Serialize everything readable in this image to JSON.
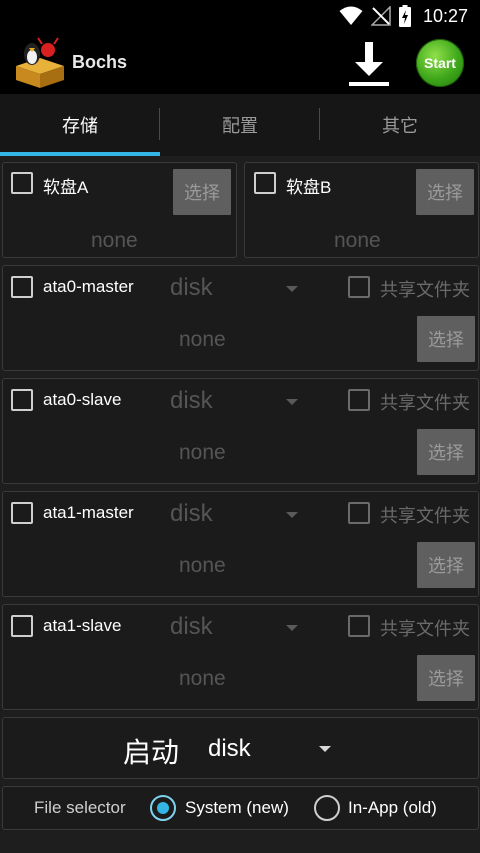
{
  "status_bar": {
    "time": "10:27",
    "icons": [
      "wifi-icon",
      "no-signal-icon",
      "battery-charging-icon"
    ]
  },
  "action_bar": {
    "title": "Bochs",
    "start_label": "Start",
    "icons": [
      "bochs-logo",
      "download-icon"
    ]
  },
  "tabs": [
    {
      "label": "存储",
      "active": true
    },
    {
      "label": "配置",
      "active": false
    },
    {
      "label": "其它",
      "active": false
    }
  ],
  "floppy_a": {
    "label": "软盘A",
    "select_label": "选择",
    "path": "none"
  },
  "floppy_b": {
    "label": "软盘B",
    "select_label": "选择",
    "path": "none"
  },
  "drives": [
    {
      "label": "ata0-master",
      "type": "disk",
      "share_label": "共享文件夹",
      "select_label": "选择",
      "path": "none"
    },
    {
      "label": "ata0-slave",
      "type": "disk",
      "share_label": "共享文件夹",
      "select_label": "选择",
      "path": "none"
    },
    {
      "label": "ata1-master",
      "type": "disk",
      "share_label": "共享文件夹",
      "select_label": "选择",
      "path": "none"
    },
    {
      "label": "ata1-slave",
      "type": "disk",
      "share_label": "共享文件夹",
      "select_label": "选择",
      "path": "none"
    }
  ],
  "boot": {
    "label": "启动",
    "value": "disk"
  },
  "file_selector": {
    "label": "File selector",
    "options": [
      {
        "label": "System (new)",
        "selected": true
      },
      {
        "label": "In-App (old)",
        "selected": false
      }
    ]
  },
  "colors": {
    "accent": "#33b5e5",
    "start_green": "#3ea61a",
    "background": "#1e1e1e"
  }
}
